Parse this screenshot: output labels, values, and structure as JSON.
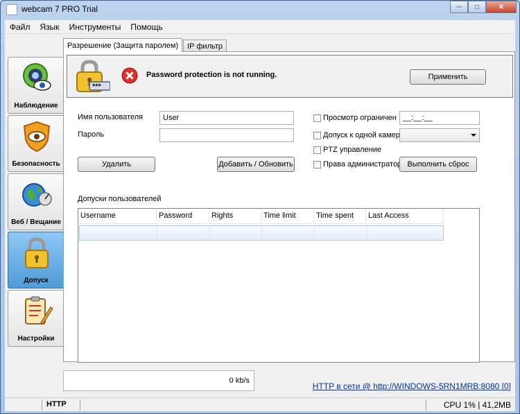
{
  "window": {
    "title": "webcam 7 PRO Trial"
  },
  "menu": [
    "Файл",
    "Язык",
    "Инструменты",
    "Помощь"
  ],
  "sidebar": {
    "items": [
      {
        "label": "Наблюдение",
        "icon": "webcam-eye-icon"
      },
      {
        "label": "Безопасность",
        "icon": "shield-eye-icon"
      },
      {
        "label": "Веб / Вещание",
        "icon": "globe-satellite-icon"
      },
      {
        "label": "Допуск",
        "icon": "padlock-icon",
        "active": true
      },
      {
        "label": "Настройки",
        "icon": "clipboard-pencil-icon"
      }
    ]
  },
  "tabs": [
    {
      "label": "Разрешение (Защита паролем)",
      "active": true
    },
    {
      "label": "IP фильтр",
      "active": false
    }
  ],
  "status": {
    "message": "Password protection is not running.",
    "apply_label": "Применить"
  },
  "form": {
    "username_label": "Имя пользователя",
    "username_value": "User",
    "password_label": "Пароль",
    "password_value": "",
    "delete_label": "Удалить",
    "add_update_label": "Добавить / Обновить",
    "view_limited_label": "Просмотр ограничен",
    "time_value": "__:__:__",
    "single_camera_label": "Допуск к одной камер",
    "ptz_label": "PTZ управление",
    "admin_label": "Права администратора",
    "reset_label": "Выполнить сброс"
  },
  "permissions": {
    "title": "Допуски пользователей",
    "columns": [
      "Username",
      "Password",
      "Rights",
      "Time limit",
      "Time spent",
      "Last Access"
    ],
    "rows": []
  },
  "bandwidth": "0 kb/s",
  "http_status": "HTTP в сети @ http://WINDOWS-5RN1MRB:8080 [0]",
  "statusbar": {
    "http": "HTTP",
    "cpu": "CPU 1% | 41,2MB"
  }
}
